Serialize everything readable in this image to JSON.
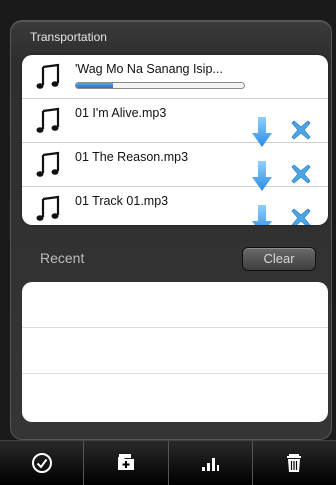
{
  "transportation": {
    "title": "Transportation",
    "items": [
      {
        "title": "'Wag Mo Na Sanang Isip...",
        "progress": 0.22,
        "icon": "music-note-icon"
      },
      {
        "title": "01 I'm Alive.mp3",
        "icon": "music-note-icon"
      },
      {
        "title": "01 The Reason.mp3",
        "icon": "music-note-icon"
      },
      {
        "title": "01 Track 01.mp3",
        "icon": "music-note-icon"
      }
    ]
  },
  "recent": {
    "title": "Recent",
    "clear_label": "Clear"
  },
  "toolbar": {
    "items": [
      {
        "icon": "check-circle-icon"
      },
      {
        "icon": "add-folder-icon"
      },
      {
        "icon": "bar-chart-icon"
      },
      {
        "icon": "trash-icon"
      }
    ]
  },
  "colors": {
    "accent_blue": "#2b8be3",
    "delete_blue": "#4aa7e8"
  }
}
